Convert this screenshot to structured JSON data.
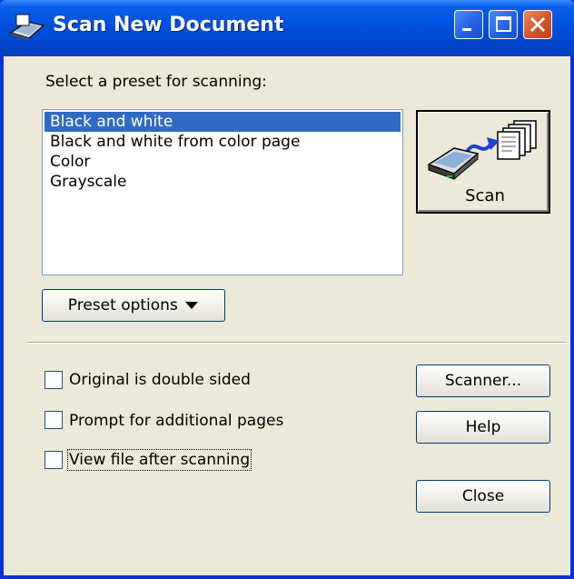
{
  "window": {
    "title": "Scan New Document",
    "icon": "scanner-icon",
    "controls": [
      "minimize-icon",
      "maximize-icon",
      "close-icon"
    ]
  },
  "preset": {
    "label": "Select a preset for scanning:",
    "items": [
      {
        "label": "Black and white",
        "selected": true
      },
      {
        "label": "Black and white from color page",
        "selected": false
      },
      {
        "label": "Color",
        "selected": false
      },
      {
        "label": "Grayscale",
        "selected": false
      }
    ],
    "options_button": "Preset options",
    "options_icon": "triangle-down-icon"
  },
  "scan_button": {
    "label": "Scan",
    "icon": "scanner-to-pages-icon"
  },
  "options": {
    "double_sided": {
      "label": "Original is double sided",
      "checked": false
    },
    "additional_pages": {
      "label": "Prompt for additional pages",
      "checked": false
    },
    "view_file": {
      "label": "View file after scanning",
      "checked": false
    }
  },
  "buttons": {
    "scanner": "Scanner...",
    "help": "Help",
    "close": "Close"
  },
  "colors": {
    "titlebar": "#0052e0",
    "selection": "#316ac5",
    "dialog_bg": "#ece9d8"
  }
}
